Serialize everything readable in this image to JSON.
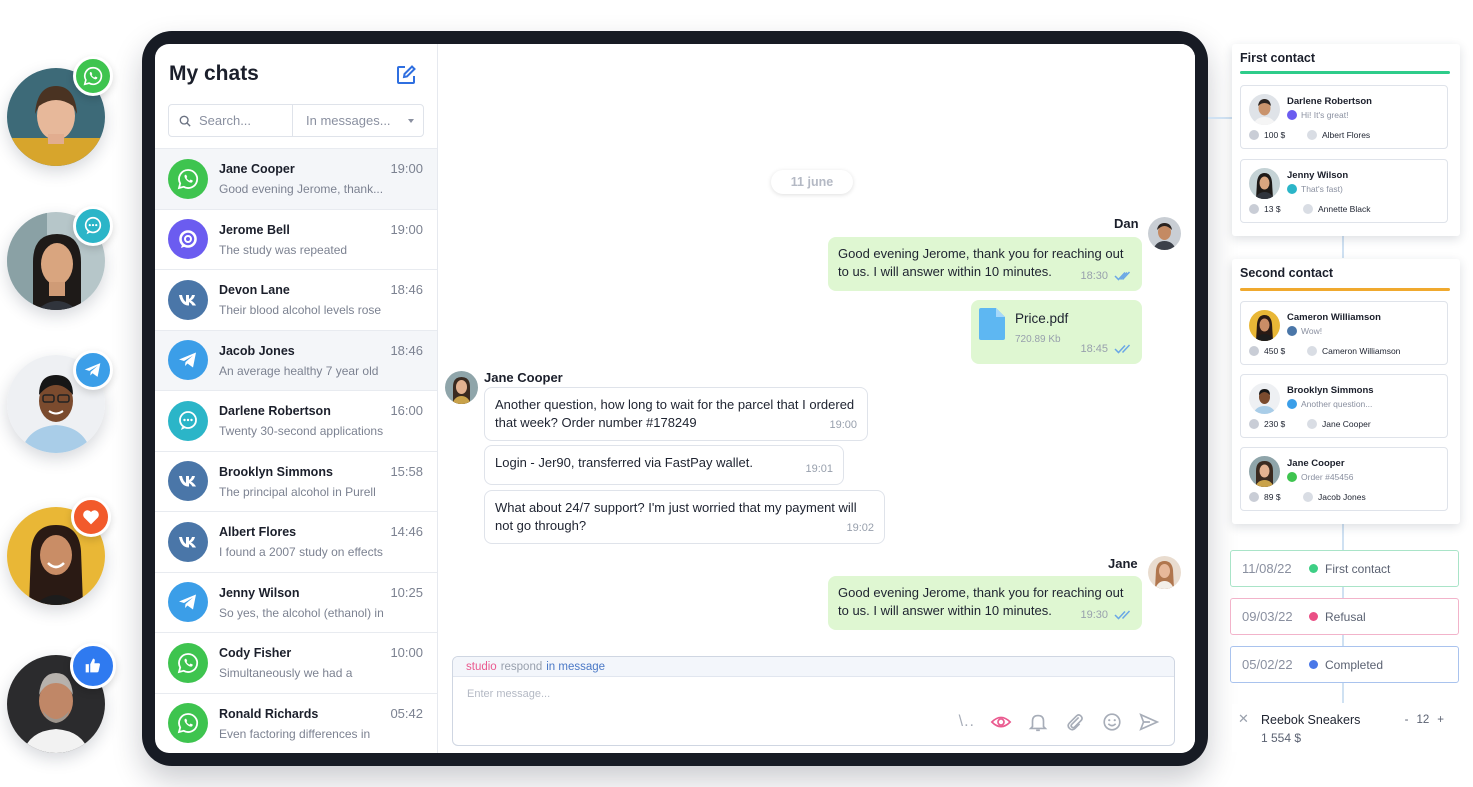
{
  "sidebar": {
    "title": "My chats",
    "search_placeholder": "Search...",
    "filter_value": "In messages...",
    "chats": [
      {
        "name": "Jane Cooper",
        "time": "19:00",
        "preview": "Good evening Jerome, thank...",
        "channel": "whatsapp-icon"
      },
      {
        "name": "Jerome Bell",
        "time": "19:00",
        "preview": "The study was repeated",
        "channel": "messenger-icon"
      },
      {
        "name": "Devon Lane",
        "time": "18:46",
        "preview": "Their blood alcohol levels rose",
        "channel": "vk-icon"
      },
      {
        "name": "Jacob Jones",
        "time": "18:46",
        "preview": "An average healthy 7 year old",
        "channel": "telegram-icon"
      },
      {
        "name": "Darlene Robertson",
        "time": "16:00",
        "preview": "Twenty 30-second applications",
        "channel": "chat-bubble-icon"
      },
      {
        "name": "Brooklyn Simmons",
        "time": "15:58",
        "preview": "The principal alcohol in Purell",
        "channel": "vk-icon"
      },
      {
        "name": "Albert Flores",
        "time": "14:46",
        "preview": "I found a 2007 study on effects",
        "channel": "vk-icon"
      },
      {
        "name": "Jenny Wilson",
        "time": "10:25",
        "preview": "So yes, the alcohol (ethanol) in",
        "channel": "telegram-icon"
      },
      {
        "name": "Cody Fisher",
        "time": "10:00",
        "preview": "Simultaneously we had a",
        "channel": "whatsapp-icon"
      },
      {
        "name": "Ronald Richards",
        "time": "05:42",
        "preview": "Even factoring differences in",
        "channel": "whatsapp-icon"
      }
    ]
  },
  "conversation": {
    "date": "11 june",
    "author_dan": "Dan",
    "author_jane_cooper": "Jane Cooper",
    "author_jane": "Jane",
    "messages": [
      {
        "text": "Good evening Jerome, thank you for reaching out to us. I will answer within 10 minutes.",
        "time": "18:30"
      },
      {
        "file_name": "Price.pdf",
        "file_size": "720.89 Kb",
        "time": "18:45"
      },
      {
        "text": "Another question, how long to wait for the parcel that I ordered that week? Order number #178249",
        "time": "19:00"
      },
      {
        "text": "Login - Jer90, transferred via FastPay wallet.",
        "time": "19:01"
      },
      {
        "text": "What about 24/7 support? I'm just worried that my payment will not go through?",
        "time": "19:02"
      },
      {
        "text": "Good evening Jerome, thank you for reaching out to us. I will answer within 10 minutes.",
        "time": "19:30"
      }
    ]
  },
  "composer": {
    "tab_studio": "studio",
    "tab_respond": "respond",
    "tab_in_message": "in message",
    "placeholder": "Enter message...",
    "slash_label": "\\.."
  },
  "pipeline": {
    "first_contact": {
      "title": "First contact",
      "color": "#2ecc8a",
      "cards": [
        {
          "name": "Darlene Robertson",
          "message": "Hi! It's great!",
          "amount": "100 $",
          "manager": "Albert Flores"
        },
        {
          "name": "Jenny Wilson",
          "message": "That's fast)",
          "amount": "13 $",
          "manager": "Annette Black"
        }
      ]
    },
    "second_contact": {
      "title": "Second contact",
      "color": "#f0a92e",
      "cards": [
        {
          "name": "Cameron Williamson",
          "message": "Wow!",
          "amount": "450 $",
          "manager": "Cameron Williamson"
        },
        {
          "name": "Brooklyn Simmons",
          "message": "Another question...",
          "amount": "230 $",
          "manager": "Jane Cooper"
        },
        {
          "name": "Jane Cooper",
          "message": "Order #45456",
          "amount": "89 $",
          "manager": "Jacob Jones"
        }
      ]
    },
    "statuses": [
      {
        "date": "11/08/22",
        "label": "First contact",
        "color": "#3ecf85"
      },
      {
        "date": "09/03/22",
        "label": "Refusal",
        "color": "#ea4f85"
      },
      {
        "date": "05/02/22",
        "label": "Completed",
        "color": "#4a78e8"
      }
    ],
    "product": {
      "name": "Reebok Sneakers",
      "price": "1 554 $",
      "qty_minus": "-",
      "qty": "12",
      "qty_plus": "+"
    }
  },
  "colors": {
    "whatsapp": "#3ec44f",
    "telegram": "#3b9ee8",
    "vk": "#4a76a8",
    "chat": "#2bb5c8",
    "messenger": "#6b5cf0",
    "heart": "#f25a2b",
    "like": "#2f7af0",
    "outgoing_bubble": "#dff7d2"
  }
}
